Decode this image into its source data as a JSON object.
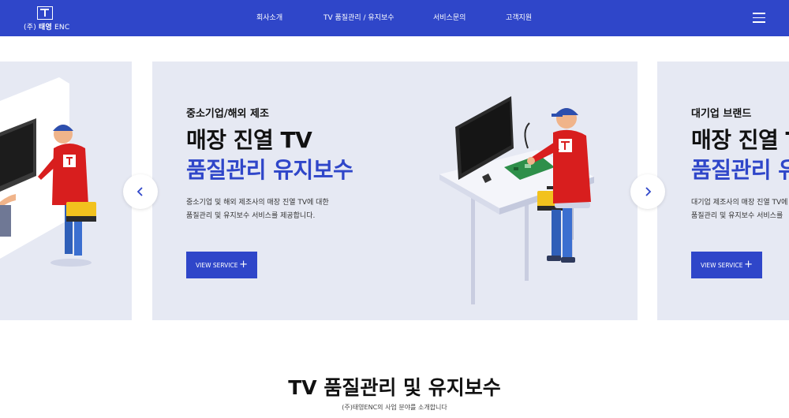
{
  "header": {
    "logo_main": "태영",
    "logo_prefix": "(주)",
    "logo_suffix": "ENC",
    "nav": [
      "회사소개",
      "TV 품질관리 / 유지보수",
      "서비스문의",
      "고객지원"
    ],
    "background": "#2f46c9"
  },
  "slider": {
    "center": {
      "eyebrow": "중소기업/해외 제조",
      "headline1": "매장 진열 TV",
      "headline2": "품질관리 유지보수",
      "desc_line1": "중소기업 및 해외 제조사의 매장 진열 TV에 대한",
      "desc_line2": "품질관리 및 유지보수 서비스를 제공합니다.",
      "button": "VIEW SERVICE"
    },
    "right": {
      "eyebrow": "대기업 브랜드",
      "headline1": "매장 진열 TV",
      "headline2": "품질관리 유지보수",
      "desc_line1": "대기업 제조사의 매장 진열 TV에",
      "desc_line2": "품질관리 및 유지보수 서비스를",
      "button": "VIEW SERVICE"
    },
    "prev_icon": "chevron-left-icon",
    "next_icon": "chevron-right-icon",
    "slide_background": "#e6e9f3",
    "accent": "#2f46c9"
  },
  "section": {
    "title": "TV 품질관리 및 유지보수",
    "subtitle": "(주)태영ENC의 사업 분야를 소개합니다"
  }
}
